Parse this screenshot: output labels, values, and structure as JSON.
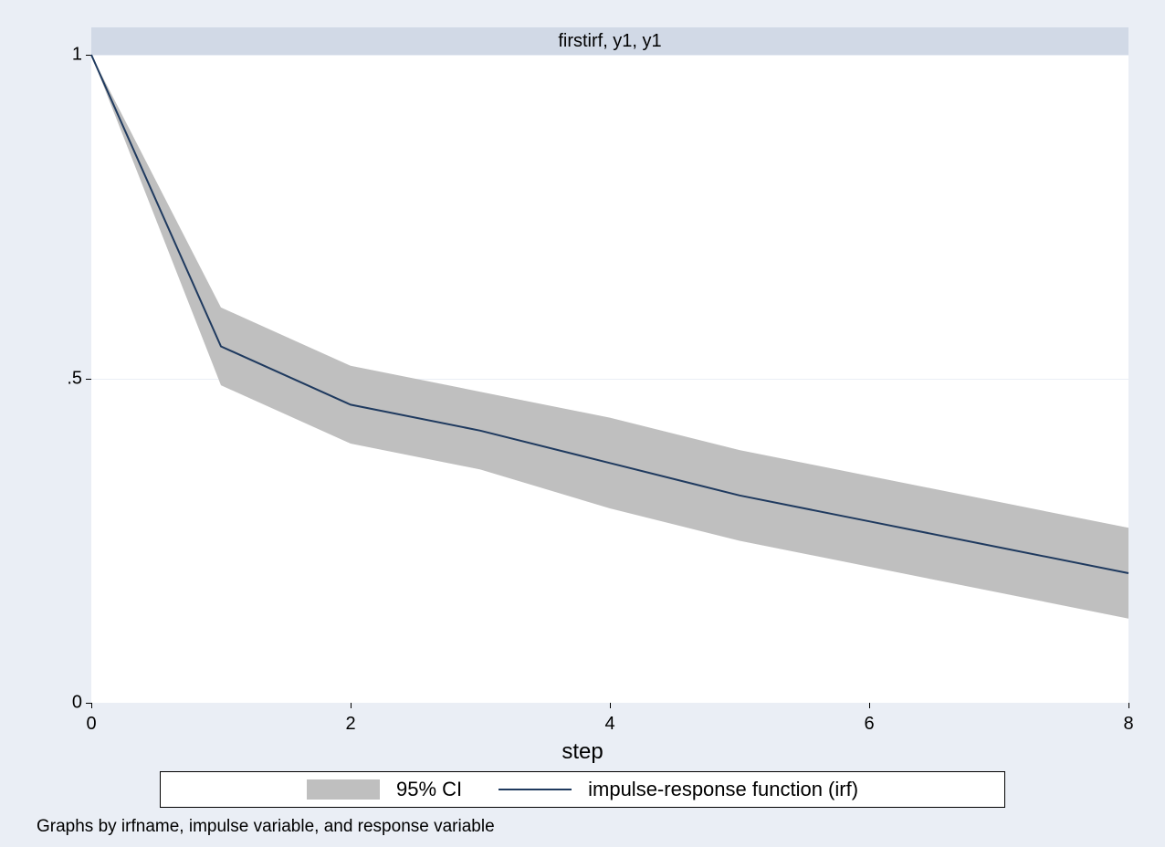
{
  "chart_data": {
    "type": "line",
    "title": "firstirf, y1, y1",
    "xlabel": "step",
    "ylabel": "",
    "xlim": [
      0,
      8
    ],
    "ylim": [
      0,
      1
    ],
    "x_ticks": [
      0,
      2,
      4,
      6,
      8
    ],
    "y_ticks": [
      0,
      0.5,
      1
    ],
    "y_tick_labels": [
      "0",
      ".5",
      "1"
    ],
    "series": [
      {
        "name": "impulse-response function (irf)",
        "x": [
          0,
          1,
          2,
          3,
          4,
          5,
          6,
          7,
          8
        ],
        "values": [
          1.0,
          0.55,
          0.46,
          0.42,
          0.37,
          0.32,
          0.28,
          0.24,
          0.2
        ]
      }
    ],
    "ci_band": {
      "name": "95% CI",
      "x": [
        0,
        1,
        2,
        3,
        4,
        5,
        6,
        7,
        8
      ],
      "lower": [
        1.0,
        0.49,
        0.4,
        0.36,
        0.3,
        0.25,
        0.21,
        0.17,
        0.13
      ],
      "upper": [
        1.0,
        0.61,
        0.52,
        0.48,
        0.44,
        0.39,
        0.35,
        0.31,
        0.27
      ]
    },
    "legend": {
      "items": [
        "95% CI",
        "impulse-response function (irf)"
      ]
    },
    "footnote": "Graphs by irfname, impulse variable, and response variable"
  },
  "colors": {
    "background": "#eaeef5",
    "plot_bg": "#ffffff",
    "title_bg": "#d1d9e6",
    "ci_fill": "#bfbfbf",
    "line": "#1f3a5f"
  }
}
